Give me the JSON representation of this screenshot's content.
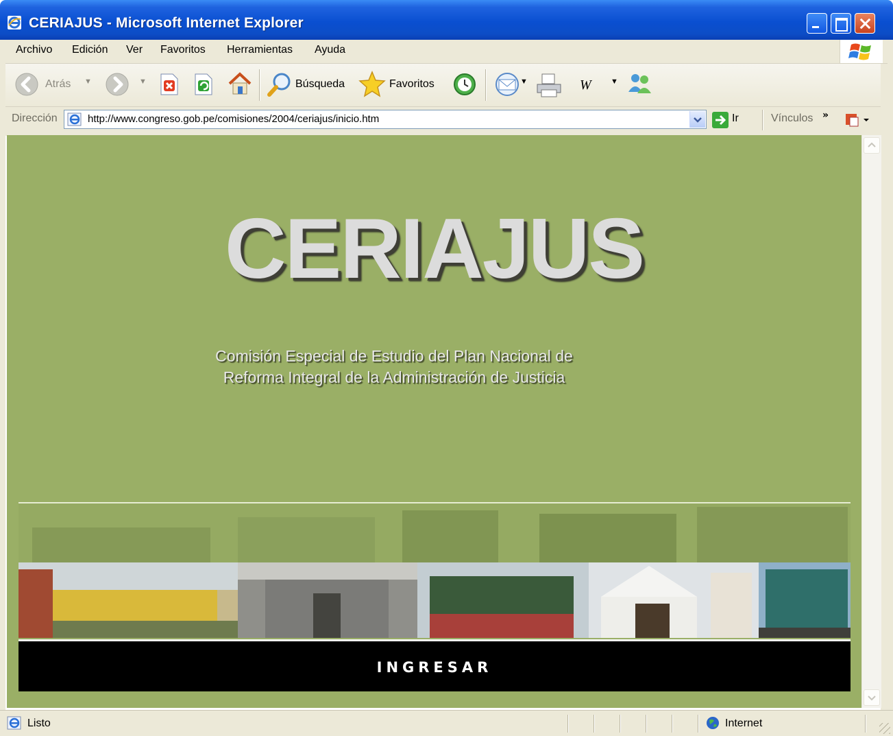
{
  "window": {
    "title": "CERIAJUS - Microsoft Internet Explorer"
  },
  "menu": [
    "Archivo",
    "Edición",
    "Ver",
    "Favoritos",
    "Herramientas",
    "Ayuda"
  ],
  "toolbar": {
    "back": "Atrás",
    "search": "Búsqueda",
    "favorites": "Favoritos"
  },
  "address": {
    "label": "Dirección",
    "url": "http://www.congreso.gob.pe/comisiones/2004/ceriajus/inicio.htm",
    "go": "Ir",
    "links": "Vínculos"
  },
  "page": {
    "brand": "CERIAJUS",
    "subtitle_line1": "Comisión Especial de Estudio del Plan Nacional de",
    "subtitle_line2": "Reforma Integral de la Administración de Justicia",
    "enter_label": "INGRESAR",
    "bg_color": "#9aaf66"
  },
  "status": {
    "text": "Listo",
    "zone": "Internet"
  }
}
